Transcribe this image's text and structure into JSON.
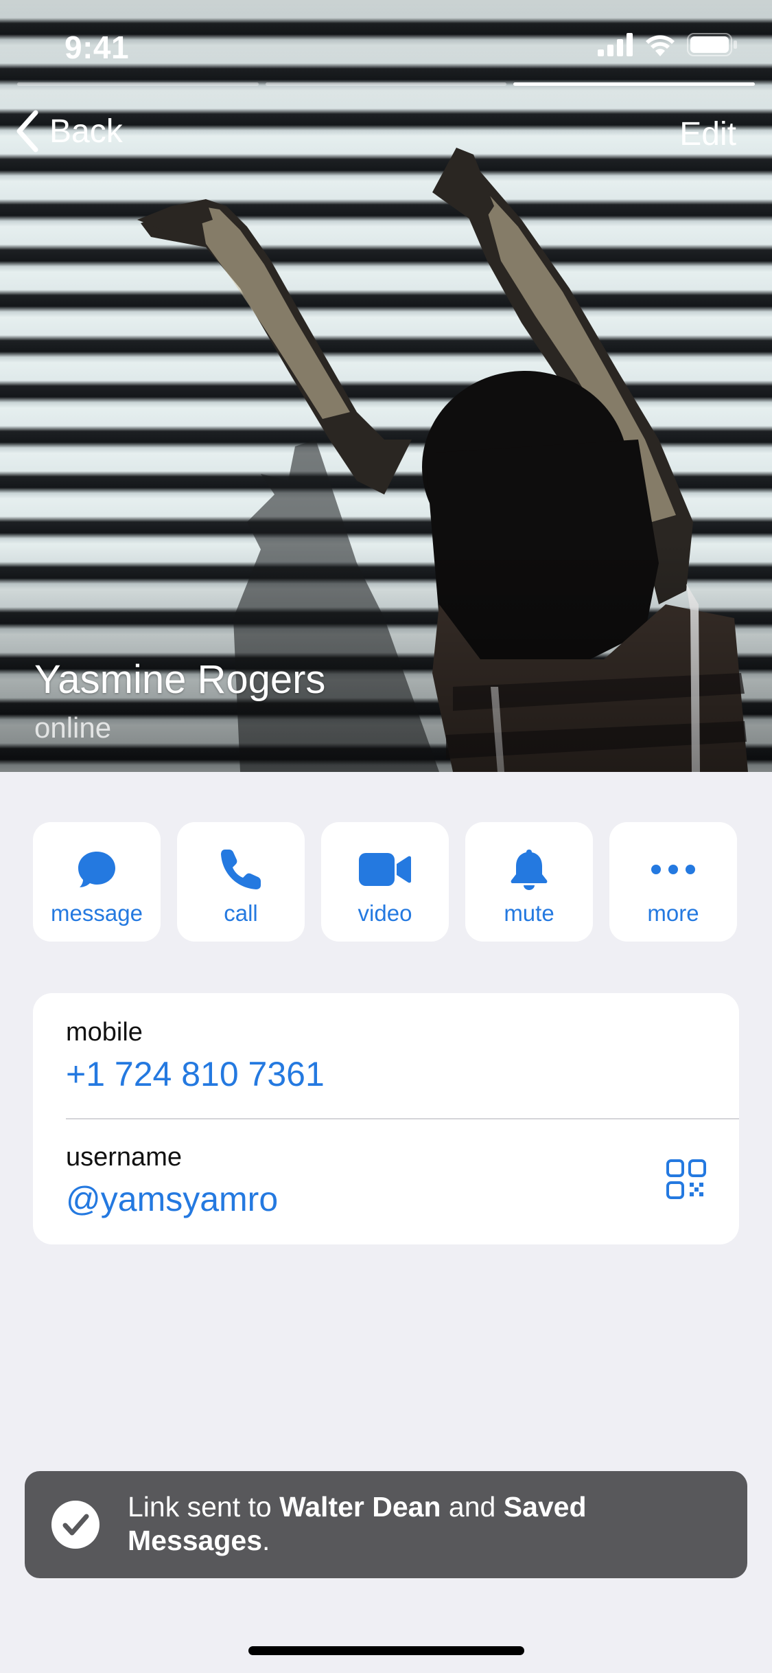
{
  "status_bar": {
    "time": "9:41"
  },
  "stories": {
    "count": 3,
    "active_index": 2
  },
  "nav": {
    "back_label": "Back",
    "edit_label": "Edit"
  },
  "profile": {
    "name": "Yasmine Rogers",
    "presence": "online"
  },
  "actions": [
    {
      "label": "message",
      "icon": "message-bubble-icon"
    },
    {
      "label": "call",
      "icon": "phone-icon"
    },
    {
      "label": "video",
      "icon": "video-camera-icon"
    },
    {
      "label": "mute",
      "icon": "bell-icon"
    },
    {
      "label": "more",
      "icon": "more-dots-icon"
    }
  ],
  "info": {
    "mobile_label": "mobile",
    "mobile_value": "+1 724 810 7361",
    "username_label": "username",
    "username_value": "@yamsyamro"
  },
  "toast": {
    "prefix": "Link sent to ",
    "recipient1": "Walter Dean",
    "joiner": " and ",
    "recipient2": "Saved Messages",
    "suffix": "."
  },
  "colors": {
    "accent": "#2479e0",
    "background": "#efeff4",
    "toast": "#58585b"
  }
}
